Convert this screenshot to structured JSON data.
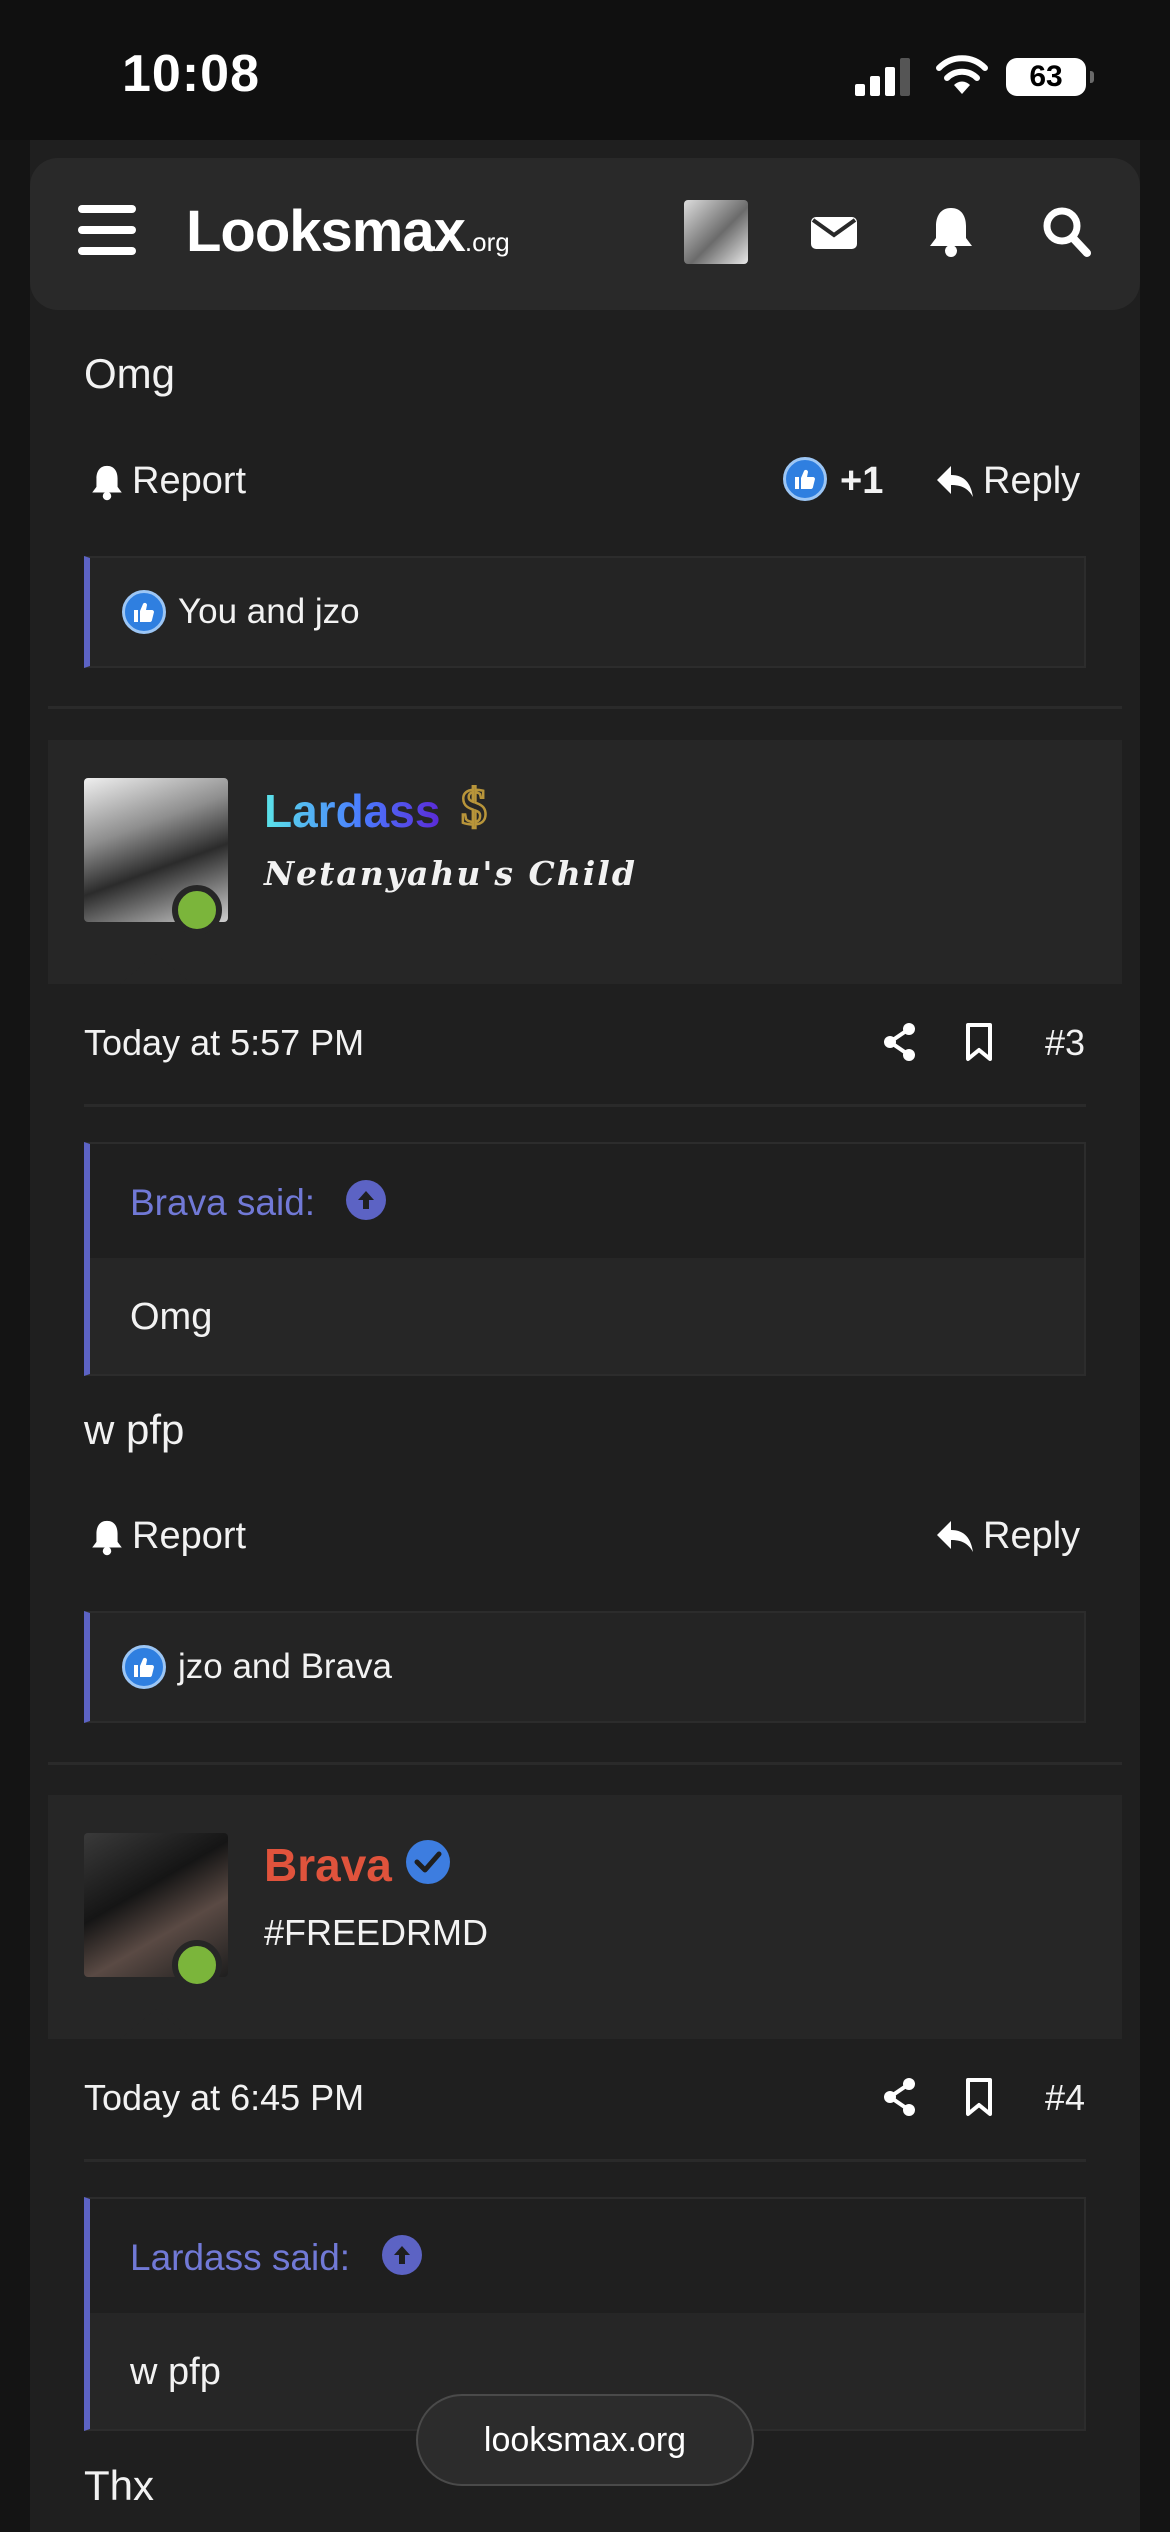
{
  "status_bar": {
    "time": "10:08",
    "battery": "63"
  },
  "nav": {
    "logo": "Looksmax",
    "logo_suffix": ".org"
  },
  "posts": [
    {
      "body": "Omg",
      "report_label": "Report",
      "reaction_score": "+1",
      "reply_label": "Reply",
      "reactions_text": "You and jzo"
    },
    {
      "username": "Lardass",
      "user_title": "Netanyahu's Child",
      "timestamp": "Today at 5:57 PM",
      "post_number": "#3",
      "quote_author": "Brava said:",
      "quote_body": "Omg",
      "body": "w pfp",
      "report_label": "Report",
      "reply_label": "Reply",
      "reactions_text": "jzo and Brava"
    },
    {
      "username": "Brava",
      "user_title": "#FREEDRMD",
      "timestamp": "Today at 6:45 PM",
      "post_number": "#4",
      "quote_author": "Lardass said:",
      "quote_body": "w pfp",
      "body": "Thx"
    }
  ],
  "url_pill": "looksmax.org",
  "colors": {
    "accent": "#5c63c4",
    "quote_text": "#7179d6",
    "username_brava": "#e0533c",
    "online": "#7bb53b",
    "like": "#2f7fe0"
  }
}
